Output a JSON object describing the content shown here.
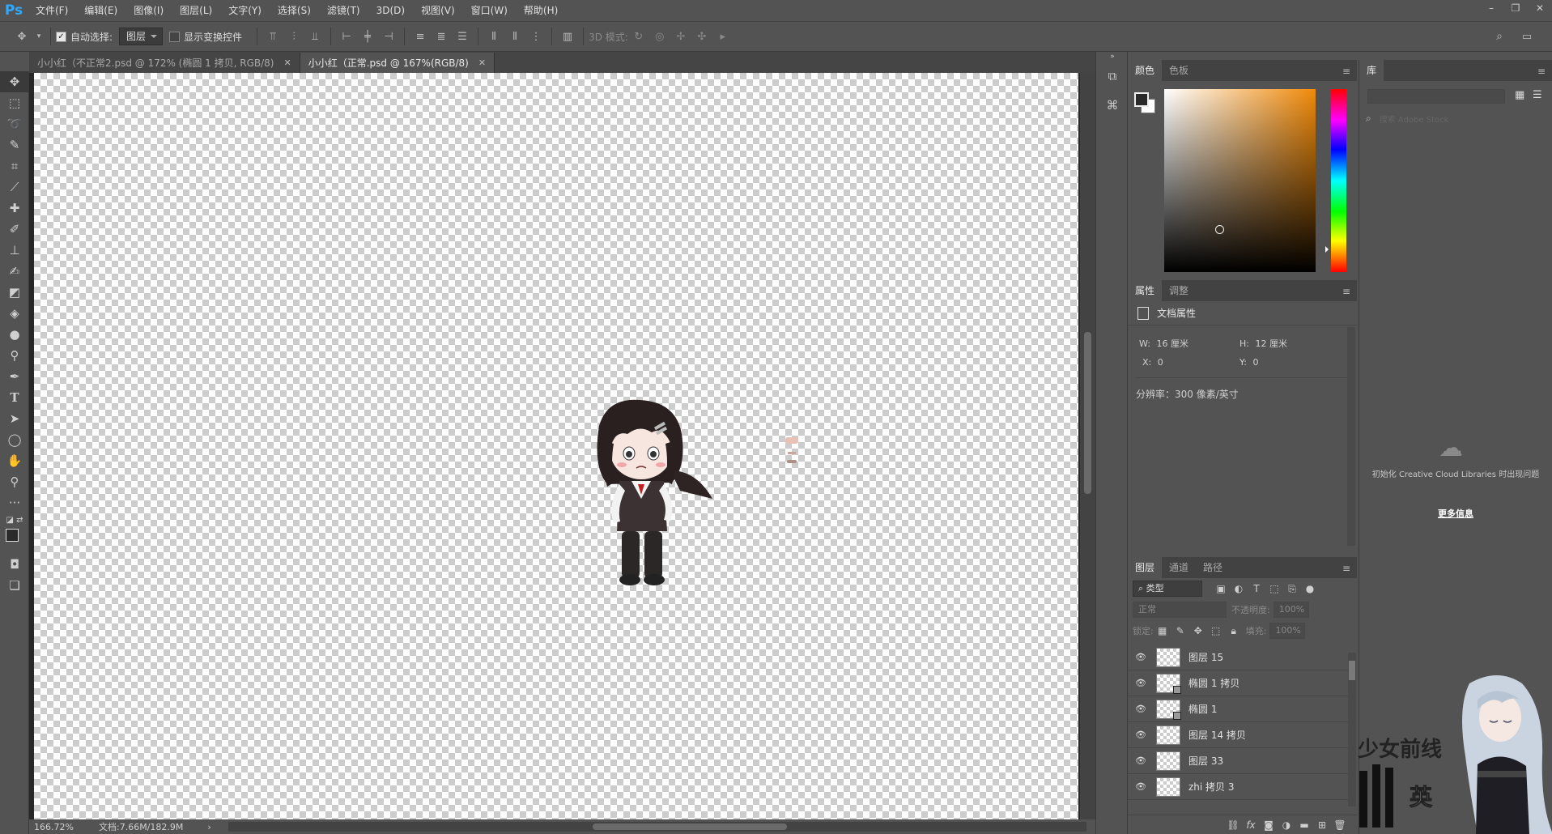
{
  "app": {
    "logo": "Ps"
  },
  "menu": [
    "文件(F)",
    "编辑(E)",
    "图像(I)",
    "图层(L)",
    "文字(Y)",
    "选择(S)",
    "滤镜(T)",
    "3D(D)",
    "视图(V)",
    "窗口(W)",
    "帮助(H)"
  ],
  "window_controls": {
    "minimize": "–",
    "restore": "❐",
    "close": "✕"
  },
  "options": {
    "auto_select_label": "自动选择:",
    "auto_select_checked": true,
    "auto_select_target": "图层",
    "show_transform_label": "显示变换控件",
    "show_transform_checked": false,
    "mode3d_label": "3D 模式:"
  },
  "tabs": [
    {
      "label": "小小红（不正常2.psd @ 172% (椭圆 1 拷贝, RGB/8)",
      "active": false,
      "close": "✕"
    },
    {
      "label": "小小红（正常.psd @ 167%(RGB/8)",
      "active": true,
      "close": "✕"
    }
  ],
  "status": {
    "zoom": "166.72%",
    "doc": "文档:7.66M/182.9M"
  },
  "color_panel": {
    "tabs": [
      "颜色",
      "色板"
    ],
    "active": "颜色",
    "fg": "#2a2a2a",
    "bg": "#ffffff",
    "hue_base": "#f08a0a"
  },
  "props_panel": {
    "tabs": [
      "属性",
      "调整"
    ],
    "active": "属性",
    "title": "文档属性",
    "w_label": "W:",
    "w_value": "16 厘米",
    "h_label": "H:",
    "h_value": "12 厘米",
    "x_label": "X:",
    "x_value": "0",
    "y_label": "Y:",
    "y_value": "0",
    "resolution": "分辨率：300 像素/英寸"
  },
  "layers_panel": {
    "tabs": [
      "图层",
      "通道",
      "路径"
    ],
    "active": "图层",
    "filter_label": "类型",
    "blend_mode": "正常",
    "opacity_label": "不透明度:",
    "opacity_value": "100%",
    "lock_label": "锁定:",
    "fill_label": "填充:",
    "fill_value": "100%",
    "layers": [
      {
        "name": "图层 15",
        "smart": false
      },
      {
        "name": "椭圆 1 拷贝",
        "smart": true
      },
      {
        "name": "椭圆 1",
        "smart": true
      },
      {
        "name": "图层 14 拷贝",
        "smart": false
      },
      {
        "name": "图层 33",
        "smart": false
      },
      {
        "name": "zhi 拷贝 3",
        "smart": false
      }
    ]
  },
  "library_panel": {
    "tab": "库",
    "search_placeholder": "搜索 Adobe Stock",
    "message": "初始化 Creative Cloud Libraries 时出现问题",
    "more_info": "更多信息"
  },
  "overlay": {
    "brand_text": "少女前线",
    "char_text": "英"
  }
}
